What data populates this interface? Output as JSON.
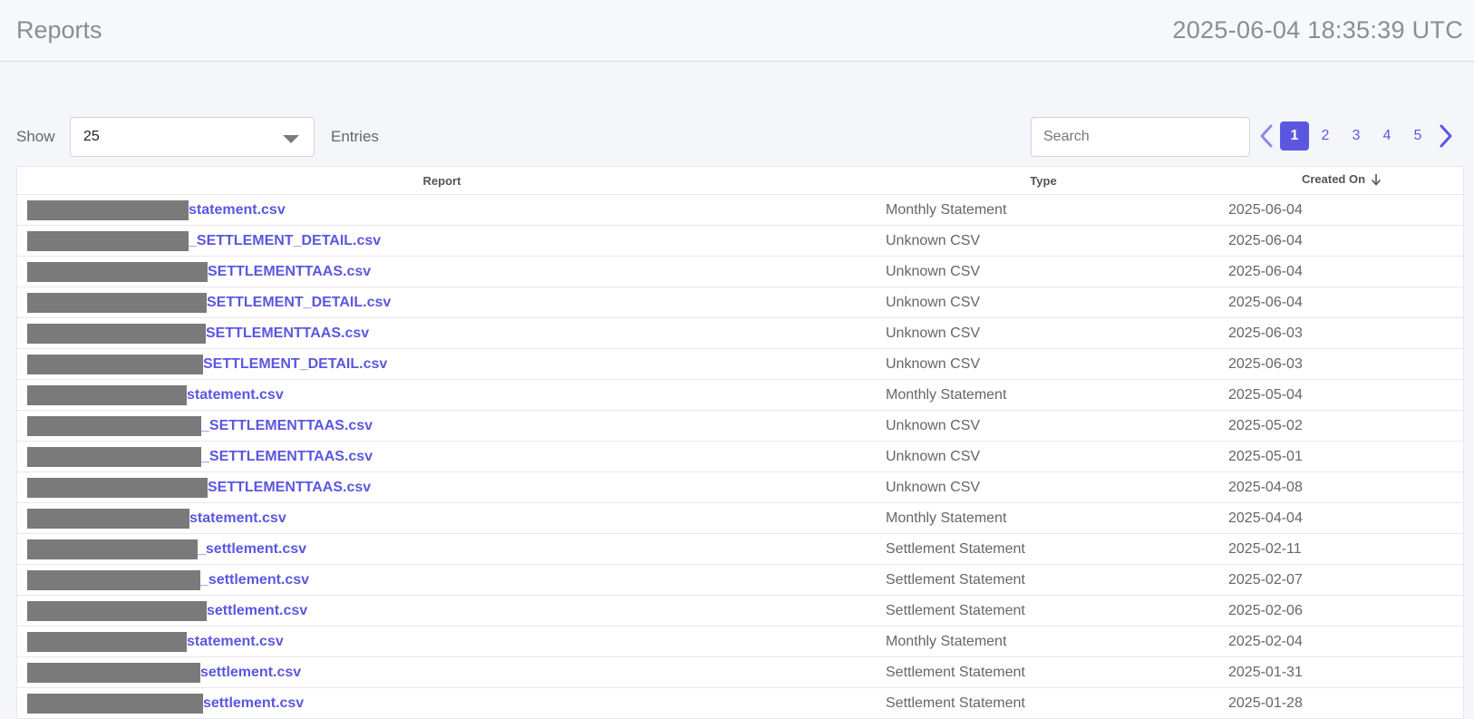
{
  "header": {
    "title": "Reports",
    "clock": "2025-06-04 18:35:39 UTC"
  },
  "controls": {
    "show_label": "Show",
    "entries_value": "25",
    "entries_label": "Entries",
    "search_placeholder": "Search"
  },
  "pagination": {
    "current": "1",
    "pages": [
      "1",
      "2",
      "3",
      "4",
      "5"
    ]
  },
  "table": {
    "columns": {
      "report": "Report",
      "type": "Type",
      "created_on": "Created On"
    },
    "rows": [
      {
        "file": "statement.csv",
        "type": "Monthly Statement",
        "date": "2025-06-04"
      },
      {
        "file": "_SETTLEMENT_DETAIL.csv",
        "type": "Unknown CSV",
        "date": "2025-06-04"
      },
      {
        "file": "SETTLEMENTTAAS.csv",
        "type": "Unknown CSV",
        "date": "2025-06-04"
      },
      {
        "file": "SETTLEMENT_DETAIL.csv",
        "type": "Unknown CSV",
        "date": "2025-06-04"
      },
      {
        "file": "SETTLEMENTTAAS.csv",
        "type": "Unknown CSV",
        "date": "2025-06-03"
      },
      {
        "file": "SETTLEMENT_DETAIL.csv",
        "type": "Unknown CSV",
        "date": "2025-06-03"
      },
      {
        "file": "statement.csv",
        "type": "Monthly Statement",
        "date": "2025-05-04"
      },
      {
        "file": "_SETTLEMENTTAAS.csv",
        "type": "Unknown CSV",
        "date": "2025-05-02"
      },
      {
        "file": "_SETTLEMENTTAAS.csv",
        "type": "Unknown CSV",
        "date": "2025-05-01"
      },
      {
        "file": "SETTLEMENTTAAS.csv",
        "type": "Unknown CSV",
        "date": "2025-04-08"
      },
      {
        "file": "statement.csv",
        "type": "Monthly Statement",
        "date": "2025-04-04"
      },
      {
        "file": "_settlement.csv",
        "type": "Settlement Statement",
        "date": "2025-02-11"
      },
      {
        "file": "_settlement.csv",
        "type": "Settlement Statement",
        "date": "2025-02-07"
      },
      {
        "file": "settlement.csv",
        "type": "Settlement Statement",
        "date": "2025-02-06"
      },
      {
        "file": "statement.csv",
        "type": "Monthly Statement",
        "date": "2025-02-04"
      },
      {
        "file": "settlement.csv",
        "type": "Settlement Statement",
        "date": "2025-01-31"
      },
      {
        "file": "settlement.csv",
        "type": "Settlement Statement",
        "date": "2025-01-28"
      }
    ]
  },
  "colors": {
    "accent": "#5b57e0",
    "redaction": "#7a7a7a"
  }
}
